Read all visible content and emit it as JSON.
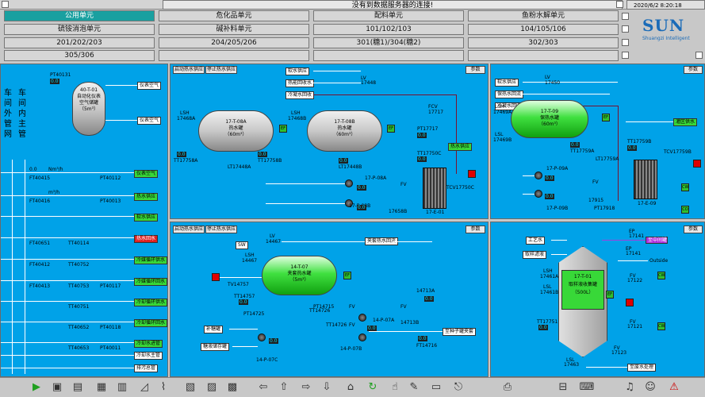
{
  "header": {
    "message": "没有到数据服务器的连接!",
    "datetime": "2020/6/2 8:20:18"
  },
  "nav": [
    [
      "公用单元",
      "危化品单元",
      "配料单元",
      "鱼粉水解单元"
    ],
    [
      "硫铵消泡单元",
      "碱补料单元",
      "101/102/103",
      "104/105/106"
    ],
    [
      "201/202/203",
      "204/205/206",
      "301(糖1)/304(糖2)",
      "302/303"
    ],
    [
      "305/306"
    ]
  ],
  "logo": {
    "name": "SUN",
    "tagline": "Shuangzi Intelligent"
  },
  "left": {
    "h1": "车间外管网",
    "h2": "车间内主管",
    "tank": "40-T-01",
    "tank_l1": "自动化仪表",
    "tank_l2": "空气储罐",
    "tank_l3": "（5m³）",
    "pt1": "PT40131",
    "lines": [
      "仪表空气",
      "仪表空气",
      "热水供应",
      "软水供应",
      "热水回水",
      "冷媒循环供水",
      "冷媒循环回水",
      "冷却循环供水",
      "冷却循环回水",
      "冷却水进管",
      "冷却水主管",
      "排污总管"
    ],
    "instr": [
      "FT40415",
      "PT40112",
      "FT40416",
      "PT40013",
      "FT40651",
      "TT40114",
      "FT40412",
      "TT40752",
      "FT40413",
      "TT40753",
      "TT40751",
      "PT40117",
      "TT40652",
      "PT40118",
      "TT40653",
      "PT40011"
    ],
    "units": [
      "Nm³/h",
      "bar",
      "m³/h",
      "bar"
    ]
  },
  "p1": {
    "btn1": "启动热水供应",
    "btn2": "停止热水供应",
    "param": "参数",
    "t1": "17-T-08A",
    "t1a": "热水罐",
    "t1b": "（60m³）",
    "t2": "17-T-08B",
    "t2a": "热水罐",
    "t2b": "（60m³）",
    "soft": "软水供应",
    "hot_ret": "热能回收水",
    "cool": "冷凝水回收",
    "hot_sup": "热水供应",
    "lv": "LV",
    "lv_id": "17448",
    "lsh1": "LSH",
    "lsh1_id": "17468A",
    "lsh2": "LSH",
    "lsh2_id": "17468B",
    "tt1": "TT17758A",
    "tt2": "TT17758B",
    "lt1": "LT17448A",
    "lt2": "LT17448B",
    "fcv": "FCV",
    "fcv_id": "17717",
    "pt": "PT17717",
    "tt3": "TT17750C",
    "tcv": "TCV17750C",
    "hx": "17-E-01",
    "pump1": "17-P-08A",
    "pump2": "17-P-08B",
    "fv": "FV",
    "fv_id": "17658B",
    "ef": "EF",
    "v0": "0.0",
    "u_c": "℃",
    "u_pct": "%",
    "u_bar": "bar",
    "u_a": "A"
  },
  "p2": {
    "btn1": "启动热水供应",
    "btn2": "停止热水供应",
    "param": "参数",
    "soft": "软水供应",
    "hot_sup": "保热水回流",
    "cool": "冷凝水回收",
    "lv": "LV",
    "lv_id": "17450",
    "lsh": "LSH",
    "lsh_id": "17469A",
    "lsl": "LSL",
    "lsl_id": "17469B",
    "t": "17-T-09",
    "ta": "保热水罐",
    "tb": "（60m³）",
    "tt1": "TT17759A",
    "lt": "LT17759A",
    "tt2": "TT17759B",
    "tcv": "TCV17759B",
    "area": "灌区供水",
    "pump1": "17-P-09A",
    "pump2": "17-P-09B",
    "fv": "FV",
    "fv_id": "17915",
    "pt": "PT17918",
    "hx": "17-E-09",
    "co": "CO",
    "ef": "EF"
  },
  "p3": {
    "btn1": "启动热水供应",
    "btn2": "停止热水供应",
    "param": "参数",
    "lv": "LV",
    "lv_id": "14467",
    "sw": "SW",
    "lsh": "LSH",
    "lsh_id": "14467",
    "t": "14-T-07",
    "ta": "夹套热水罐",
    "tb": "（5m³）",
    "tv": "TV14757",
    "tt": "TT14757",
    "ret": "夹套热水回流",
    "pt1": "PT14715",
    "pt2": "PT14716",
    "pt3": "PT14725",
    "tt2": "TT14726",
    "fv1": "FV",
    "fv1_id": "14713A",
    "fv2": "FV",
    "fv2_id": "14713B",
    "ft": "FT14716",
    "p1": "14-P-07A",
    "p2": "14-P-07B",
    "p3": "14-P-07C",
    "supply": "至种子罐夹套",
    "add": "补糖罐",
    "sug": "糖液储存罐",
    "lt": "LT14716",
    "ef": "EF"
  },
  "p4": {
    "param": "参数",
    "proc": "工艺水",
    "back": "取样滤液",
    "t": "17-T-01",
    "ta": "取样液收集罐",
    "tb": "（500L）",
    "ep": "EP",
    "ep_id": "17141",
    "fv1": "FV",
    "fv1_id": "17122",
    "fv2": "FV",
    "fv2_id": "17121",
    "lsh": "LSH",
    "lsh_id": "17461A",
    "lsl": "LSL",
    "lsl_id": "17461B",
    "lsh2": "LSH",
    "lsh2_id": "17460",
    "tt": "TT17751",
    "pt": "PT17751",
    "ef": "EF",
    "cw": "CW",
    "out": "Outside",
    "to": "至废水处理",
    "ratio": "至中间罐",
    "lsl2": "LSL",
    "lsl2_id": "17463",
    "fv3": "FV",
    "fv3_id": "17123"
  }
}
